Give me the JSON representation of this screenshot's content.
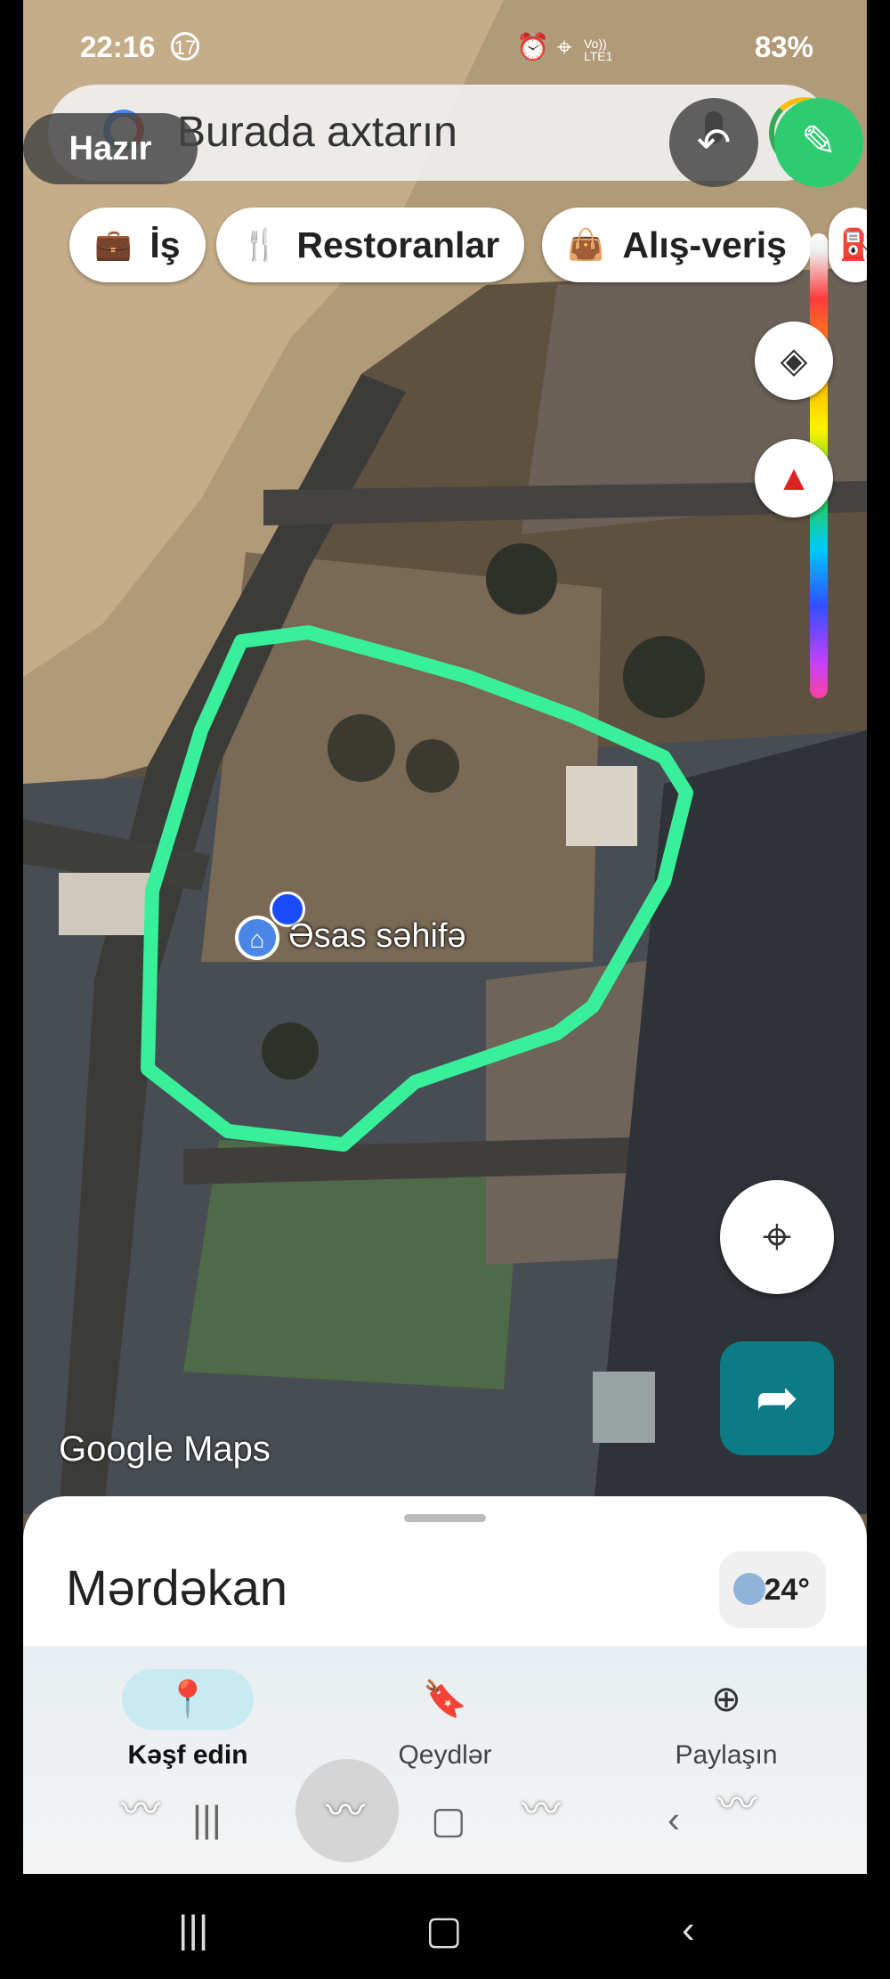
{
  "status_bar": {
    "time": "22:16",
    "notif_count": "17",
    "network_top": "Vo))",
    "network_bottom": "LTE1",
    "battery": "83%"
  },
  "search": {
    "placeholder": "Burada axtarın"
  },
  "overlay": {
    "ready_label": "Hazır"
  },
  "chips": [
    {
      "label": "İş",
      "icon": "briefcase-icon"
    },
    {
      "label": "Restoranlar",
      "icon": "fork-knife-icon"
    },
    {
      "label": "Alış-veriş",
      "icon": "shopping-bag-icon"
    }
  ],
  "map": {
    "home_label": "Əsas səhifə",
    "watermark": "Google Maps",
    "outline_color": "#39f09a"
  },
  "sheet": {
    "place_name": "Mərdəkan",
    "temperature": "24°"
  },
  "bottom_nav": [
    {
      "label": "Kəşf edin",
      "icon": "location-pin-icon",
      "active": true
    },
    {
      "label": "Qeydlər",
      "icon": "bookmark-icon",
      "active": false
    },
    {
      "label": "Paylaşın",
      "icon": "add-circle-icon",
      "active": false
    }
  ],
  "colors": {
    "accent_green": "#2ecc71",
    "directions_teal": "#0b7b86"
  }
}
